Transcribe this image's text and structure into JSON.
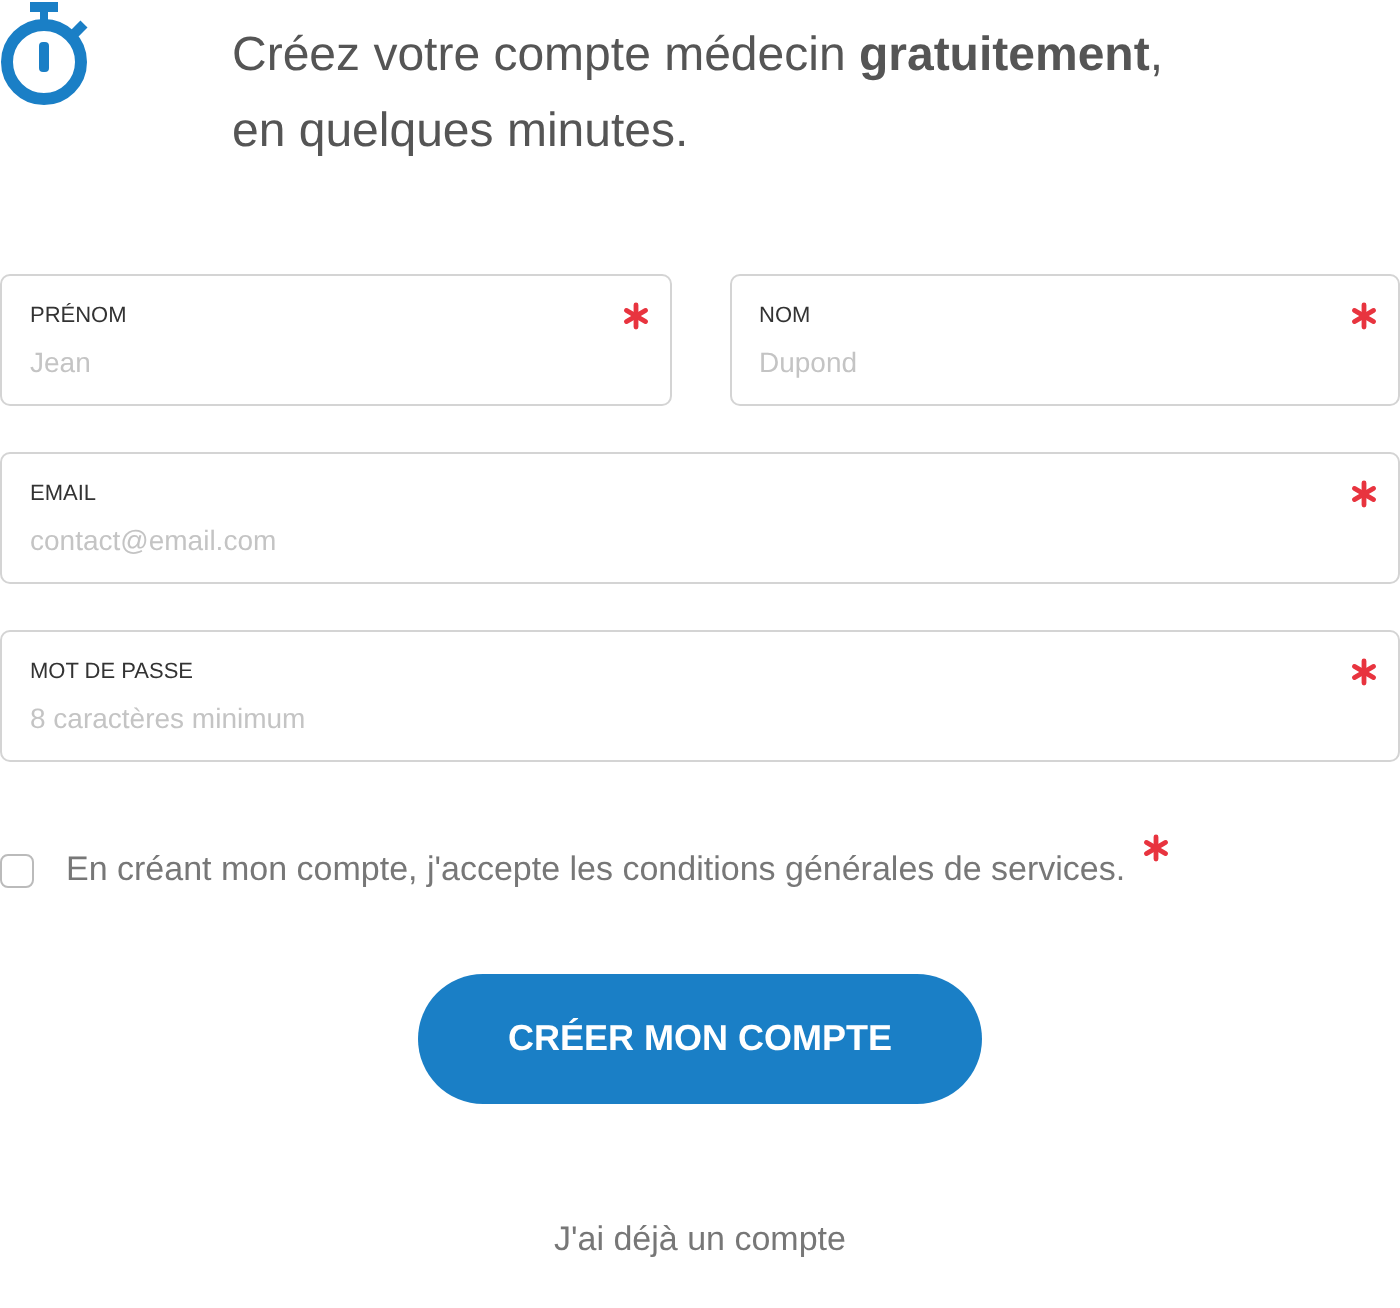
{
  "heading": "Créez votre compte médecin **gratuitement**,\nen quelques minutes.",
  "field_rows": [
    [
      {
        "label": "PRÉNOM",
        "placeholder": "Jean",
        "required": true
      },
      {
        "label": "NOM",
        "placeholder": "Dupond",
        "required": true
      }
    ],
    [
      {
        "label": "EMAIL",
        "placeholder": "contact@email.com",
        "required": true
      }
    ],
    [
      {
        "label": "MOT DE PASSE",
        "placeholder": "8 caractères minimum",
        "required": true
      }
    ]
  ],
  "terms": {
    "text": "En créant mon compte, j'accepte les conditions générales de services.",
    "checked": false,
    "required": true
  },
  "submit_button": "CRÉER MON COMPTE",
  "login_link": "J'ai déjà un compte"
}
